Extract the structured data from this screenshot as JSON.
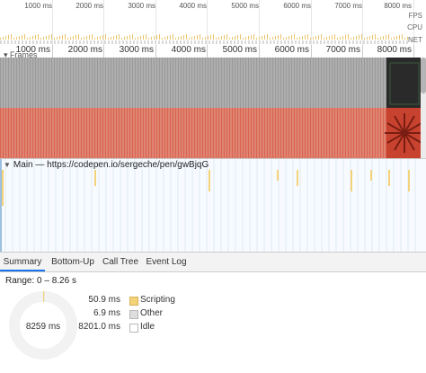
{
  "overview": {
    "ticks": [
      "1000 ms",
      "2000 ms",
      "3000 ms",
      "4000 ms",
      "5000 ms",
      "6000 ms",
      "7000 ms",
      "8000 ms"
    ],
    "tracks": [
      "FPS",
      "CPU",
      "NET"
    ]
  },
  "ruler": {
    "ticks": [
      "1000 ms",
      "2000 ms",
      "3000 ms",
      "4000 ms",
      "5000 ms",
      "6000 ms",
      "7000 ms",
      "8000 ms"
    ],
    "section_label": "Frames"
  },
  "main_thread": {
    "label": "Main — https://codepen.io/sergeche/pen/gwBjqG"
  },
  "tabs": [
    "Summary",
    "Bottom-Up",
    "Call Tree",
    "Event Log"
  ],
  "active_tab": "Summary",
  "summary": {
    "range": "Range: 0 – 8.26 s",
    "total": "8259 ms",
    "rows": [
      {
        "value": "50.9 ms",
        "label": "Scripting",
        "color": "#f3d27a"
      },
      {
        "value": "6.9 ms",
        "label": "Other",
        "color": "#dddddd"
      },
      {
        "value": "8201.0 ms",
        "label": "Idle",
        "color": "#ffffff"
      }
    ]
  },
  "colors": {
    "frame_gray": "#9a9a9a",
    "frame_red": "#d9644f",
    "scripting": "#f3d27a",
    "accent": "#1a73e8"
  }
}
